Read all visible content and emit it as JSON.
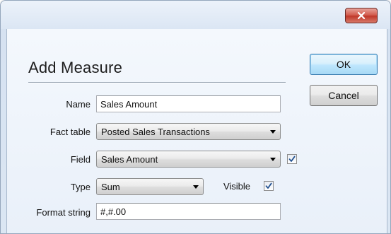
{
  "window": {
    "close_icon": "close-x-icon",
    "close_color": "#c0392b"
  },
  "dialog": {
    "title": "Add Measure",
    "ok_label": "OK",
    "cancel_label": "Cancel"
  },
  "form": {
    "name": {
      "label": "Name",
      "value": "Sales Amount"
    },
    "fact_table": {
      "label": "Fact table",
      "value": "Posted Sales Transactions"
    },
    "field": {
      "label": "Field",
      "value": "Sales Amount",
      "checked": true
    },
    "type": {
      "label": "Type",
      "value": "Sum"
    },
    "visible": {
      "label": "Visible",
      "checked": true
    },
    "format_string": {
      "label": "Format string",
      "value": "#,#.00"
    }
  },
  "icons": {
    "dropdown": "chevron-down-icon",
    "check": "checkmark-icon"
  },
  "colors": {
    "accent": "#3c7fb1",
    "check": "#1f4f8f"
  }
}
